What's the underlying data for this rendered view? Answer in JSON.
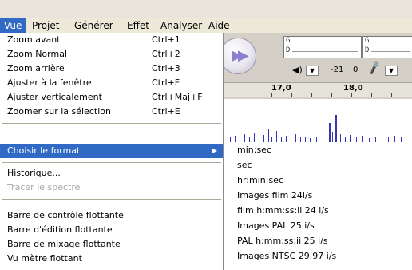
{
  "menubar": {
    "items": [
      "Vue",
      "Projet",
      "Générer",
      "Effet",
      "Analyser",
      "Aide"
    ],
    "active_index": 0
  },
  "toolbar": {
    "meter_top_label": "G",
    "meter_bottom_label": "D",
    "meter2_top_label": "G",
    "meter2_bottom_label": "D",
    "meter_scale_value": "-21",
    "meter_scale_zero": "0",
    "ruler_labels": [
      "17,0",
      "18,0"
    ]
  },
  "view_menu": {
    "items": [
      {
        "label": "Zoom avant",
        "shortcut": "Ctrl+1"
      },
      {
        "label": "Zoom Normal",
        "shortcut": "Ctrl+2"
      },
      {
        "label": "Zoom arrière",
        "shortcut": "Ctrl+3"
      },
      {
        "label": "Ajuster à la fenêtre",
        "shortcut": "Ctrl+F"
      },
      {
        "label": "Ajuster verticalement",
        "shortcut": "Ctrl+Maj+F"
      },
      {
        "label": "Zoomer sur la sélection",
        "shortcut": "Ctrl+E"
      },
      {
        "label": "Choisir le format",
        "shortcut": ""
      },
      {
        "label": "Historique...",
        "shortcut": ""
      },
      {
        "label": "Tracer le spectre",
        "shortcut": ""
      },
      {
        "label": "Barre de contrôle flottante",
        "shortcut": ""
      },
      {
        "label": "Barre d'édition flottante",
        "shortcut": ""
      },
      {
        "label": "Barre de mixage flottante",
        "shortcut": ""
      },
      {
        "label": "Vu mètre flottant",
        "shortcut": ""
      }
    ],
    "highlighted_index": 6,
    "disabled_indices": [
      8
    ]
  },
  "format_submenu": {
    "items": [
      "min:sec",
      "sec",
      "hr:min:sec",
      "Images film 24i/s",
      "film h:mm:ss:ii 24 i/s",
      "Images PAL 25 i/s",
      "PAL h:mm:ss:ii 25 i/s",
      "Images NTSC 29.97 i/s"
    ]
  },
  "colors": {
    "highlight": "#316ac5",
    "waveform": "#3a36b0",
    "menu_bg": "#ffffff",
    "app_bg": "#d4d0c8"
  }
}
